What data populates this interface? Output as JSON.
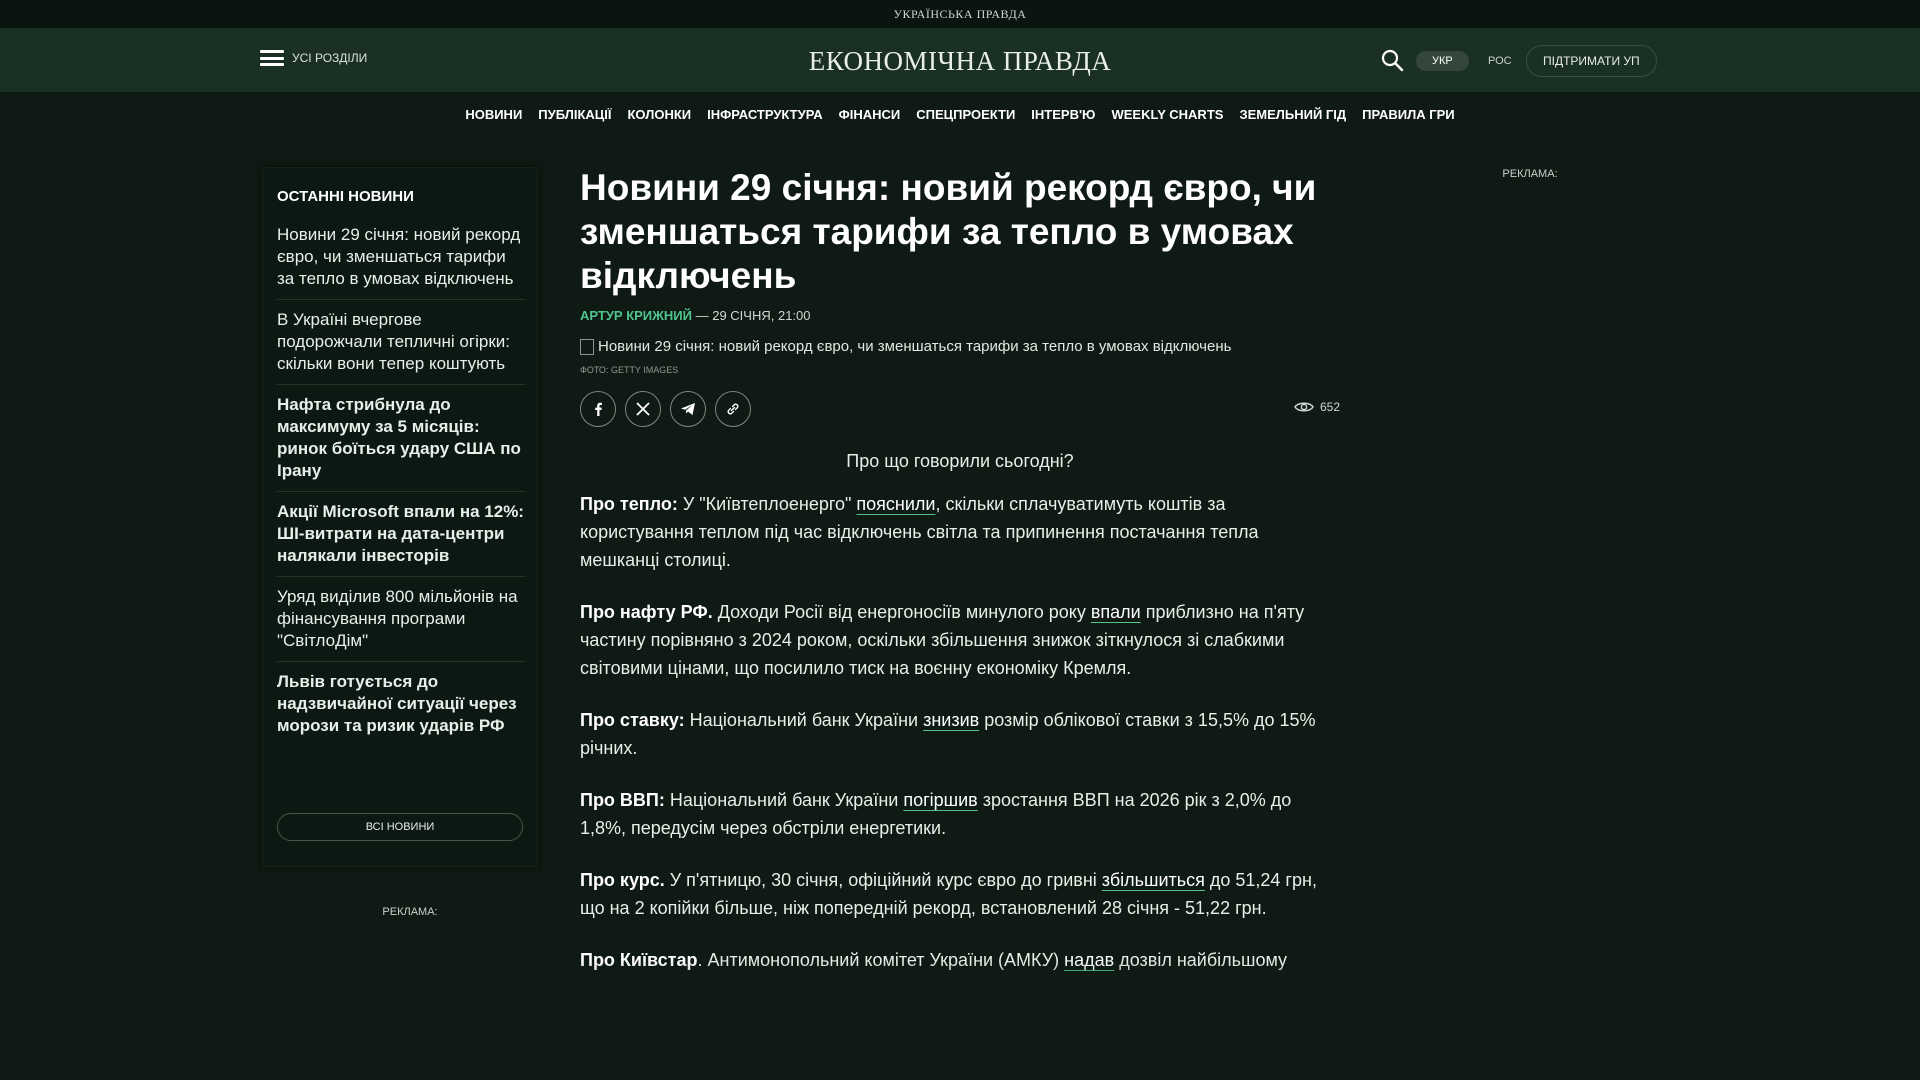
{
  "topstrip": {
    "brand": "УКРАЇНСЬКА ПРАВДА"
  },
  "header": {
    "menu_label": "УСІ РОЗДІЛИ",
    "logo": "ЕКОНОМІЧНА ПРАВДА",
    "lang_ukr": "УКР",
    "lang_ros": "РОС",
    "support": "ПІДТРИМАТИ УП"
  },
  "nav": [
    "НОВИНИ",
    "ПУБЛІКАЦІЇ",
    "КОЛОНКИ",
    "ІНФРАСТРУКТУРА",
    "ФІНАНСИ",
    "СПЕЦПРОЕКТИ",
    "ІНТЕРВ'Ю",
    "WEEKLY CHARTS",
    "ЗЕМЕЛЬНИЙ ГІД",
    "ПРАВИЛА ГРИ"
  ],
  "sidebar": {
    "heading": "ОСТАННІ НОВИНИ",
    "items": [
      {
        "text": "Новини 29 січня: новий рекорд євро, чи зменшаться тарифи за тепло в умовах відключень",
        "bold": false
      },
      {
        "text": "В Україні вчергове подорожчали тепличні огірки: скільки вони тепер коштують",
        "bold": false
      },
      {
        "text": "Нафта стрибнула до максимуму за 5 місяців: ринок боїться удару США по Ірану",
        "bold": true
      },
      {
        "text": "Акції Microsoft впали на 12%: ШІ-витрати на дата-центри налякали інвесторів",
        "bold": true
      },
      {
        "text": "Уряд виділив 800 мільйонів на фінансування програми \"СвітлоДім\"",
        "bold": false
      },
      {
        "text": "Львів готується до надзвичайної ситуації через морози та ризик ударів РФ",
        "bold": true
      }
    ],
    "all_news": "ВСІ НОВИНИ"
  },
  "ads": {
    "left": "РЕКЛАМА:",
    "right": "РЕКЛАМА:"
  },
  "article": {
    "title": "Новини 29 січня: новий рекорд євро, чи зменшаться тарифи за тепло в умовах відключень",
    "author": "АРТУР КРИЖНИЙ",
    "date": "— 29 СІЧНЯ, 21:00",
    "image_alt": "Новини 29 січня: новий рекорд євро, чи зменшаться тарифи за тепло в умовах відключень",
    "photo_credit": "Фото: GETTY IMAGES",
    "views": "652",
    "lead": "Про що говорили сьогодні?",
    "paragraphs": {
      "p1": {
        "label": "Про тепло:",
        "t1": " У \"Київтеплоенерго\" ",
        "link": "пояснили",
        "t2": ", скільки сплачуватимуть коштів за користування теплом під час відключень світла та припинення постачання тепла мешканці столиці."
      },
      "p2": {
        "label": "Про нафту РФ.",
        "t1": " Доходи Росії від енергоносіїв минулого року ",
        "link": "впали",
        "t2": " приблизно на п'яту частину порівняно з 2024 роком, оскільки збільшення знижок зіткнулося зі слабкими світовими цінами, що посилило тиск на воєнну економіку Кремля."
      },
      "p3": {
        "label": "Про ставку:",
        "t1": " Національний банк України ",
        "link": "знизив",
        "t2": " розмір облікової ставки з 15,5% до 15% річних."
      },
      "p4": {
        "label": "Про ВВП:",
        "t1": " Національний банк України ",
        "link": "погіршив",
        "t2": " зростання ВВП на 2026 рік з 2,0% до 1,8%, передусім через обстріли енергетики."
      },
      "p5": {
        "label": "Про курс.",
        "t1": " У п'ятницю, 30 січня, офіційний курс євро до гривні ",
        "link": "збільшиться",
        "t2": " до 51,24 грн, що на 2 копійки більше, ніж попередній рекорд, встановлений 28 січня - 51,22 грн."
      },
      "p6": {
        "label": "Про Київстар",
        "t1": ". Антимонопольний комітет України (АМКУ) ",
        "link": "надав",
        "t2": " дозвіл найбільшому"
      }
    }
  }
}
